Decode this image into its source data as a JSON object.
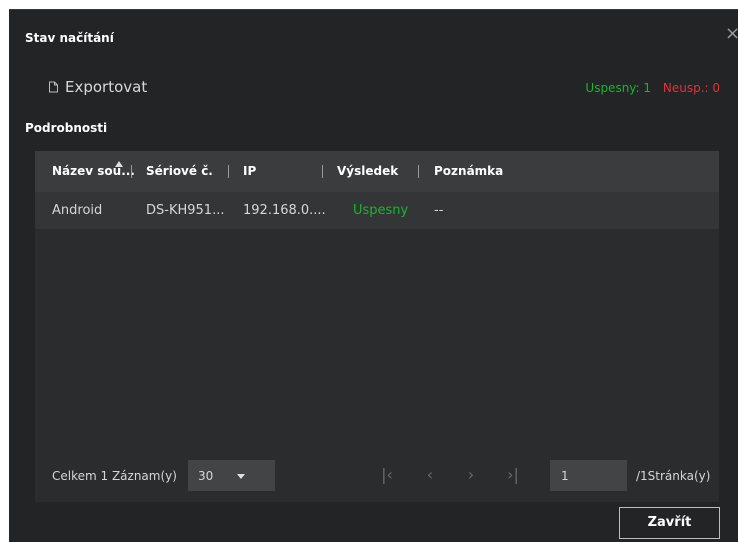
{
  "dialog": {
    "title": "Stav načítání",
    "close_icon": "close-icon"
  },
  "toolbar": {
    "export_label": "Exportovat",
    "success_count": "Uspesny: 1",
    "fail_count": "Neusp.: 0",
    "success_color": "#17b62c",
    "fail_color": "#e0333a"
  },
  "details": {
    "section_title": "Podrobnosti",
    "columns": [
      "Název sou...",
      "Sériové č.",
      "IP",
      "Výsledek",
      "Poznámka"
    ],
    "rows": [
      {
        "name": "Android",
        "serial": "DS-KH951...",
        "ip": "192.168.0....",
        "result": "Uspesny",
        "note": "--"
      }
    ]
  },
  "pagination": {
    "total": "Celkem 1 Záznam(y)",
    "page_size": "30",
    "current_page": "1",
    "page_total": "/1Stránka(y)"
  },
  "footer": {
    "close_button": "Zavřít"
  }
}
